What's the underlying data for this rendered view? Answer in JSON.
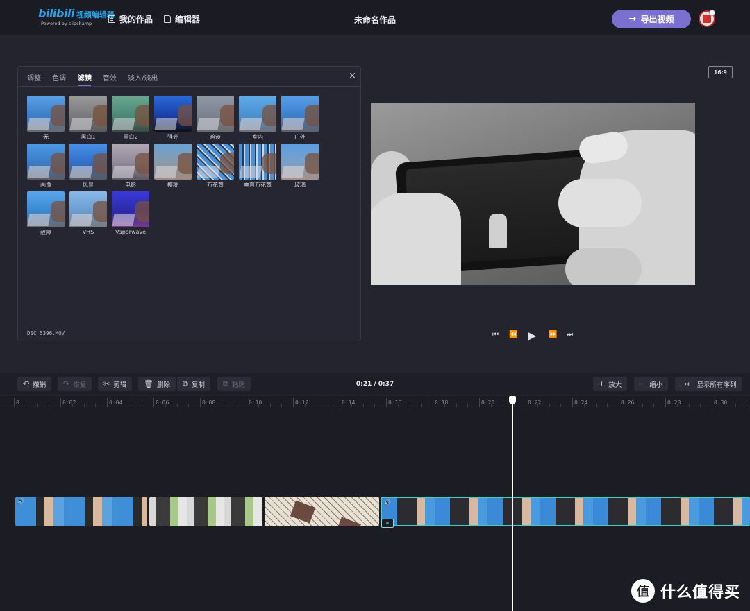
{
  "header": {
    "logo_bili": "bilibili",
    "logo_text": "视频编辑器",
    "logo_sub": "Powered by clipchamp",
    "nav_works": "我的作品",
    "nav_editor": "编辑器",
    "project_title": "未命名作品",
    "export_label": "导出视频"
  },
  "panel": {
    "tabs": [
      "调整",
      "色调",
      "滤镜",
      "音效",
      "淡入/淡出"
    ],
    "close": "×",
    "filters": [
      {
        "label": "无",
        "bg": "linear-gradient(180deg,#5aa0e6 0%,#3a7ec8 55%,#6a6a70 100%)"
      },
      {
        "label": "黑白1",
        "bg": "linear-gradient(180deg,#9a9a9a 0%,#7a7a7a 55%,#5a5a5a 100%)"
      },
      {
        "label": "黑白2",
        "bg": "linear-gradient(180deg,#6aa690 0%,#4a8a74 55%,#3a4a44 100%)"
      },
      {
        "label": "强光",
        "bg": "linear-gradient(180deg,#2a6ad8 0%,#1a40a8 55%,#101018 100%)"
      },
      {
        "label": "暗淡",
        "bg": "linear-gradient(180deg,#9098a4 0%,#7a8290 55%,#6a6a6e 100%)"
      },
      {
        "label": "室内",
        "bg": "linear-gradient(180deg,#60aae8 0%,#4a90d0 55%,#707078 100%)"
      },
      {
        "label": "户外",
        "bg": "linear-gradient(180deg,#5a9ee8 0%,#3a80cc 55%,#606068 100%)"
      },
      {
        "label": "画像",
        "bg": "linear-gradient(180deg,#4e9ae6 0%,#3a7ac4 55%,#5a5a62 100%)"
      },
      {
        "label": "风景",
        "bg": "linear-gradient(180deg,#4a90e8 0%,#2f6ec8 55%,#585860 100%)"
      },
      {
        "label": "电影",
        "bg": "linear-gradient(180deg,#b0a8b4 0%,#908898 55%,#605860 100%)"
      },
      {
        "label": "模糊",
        "bg": "linear-gradient(180deg,#6aa2d6 0%,#8a9aa8 55%,#a08a80 100%)"
      },
      {
        "label": "万花筒",
        "bg": "repeating-linear-gradient(45deg,#4a90d8 0px,#4a90d8 5px,#2a3a4a 5px,#2a3a4a 7px,#c8d8e8 7px,#c8d8e8 9px)"
      },
      {
        "label": "垂直万花筒",
        "bg": "repeating-linear-gradient(90deg,#4a90d8 0px,#4a90d8 5px,#2a3a4a 5px,#2a3a4a 7px,#c8d8e8 7px,#c8d8e8 9px)"
      },
      {
        "label": "玻璃",
        "bg": "linear-gradient(180deg,#5a9ee0 0%,#7aa0c8 55%,#a89088 100%)"
      },
      {
        "label": "故障",
        "bg": "linear-gradient(180deg,#5aa6ee 0%,#3a88d0 55%,#68686e 100%)"
      },
      {
        "label": "VHS",
        "bg": "linear-gradient(180deg,#8ab8e8 0%,#6a9cd0 55%,#7a7a80 100%)"
      },
      {
        "label": "Vaporwave",
        "bg": "linear-gradient(180deg,#3a3ad8 0%,#2a2aa8 55%,#7a3a8a 100%)"
      }
    ],
    "filename": "DSC_5396.MOV"
  },
  "preview": {
    "ratio": "16:9",
    "transport": {
      "first": "⏮",
      "back": "⏪",
      "play": "▶",
      "fwd": "⏩",
      "last": "⏭"
    }
  },
  "toolbar": {
    "undo": "撤销",
    "redo": "恢复",
    "cut": "剪辑",
    "delete": "删除",
    "copy": "复制",
    "paste": "粘贴",
    "timecode": "0:21 / 0:37",
    "zoom_in": "放大",
    "zoom_out": "缩小",
    "show_all": "显示所有序列"
  },
  "timeline": {
    "ticks": [
      "0",
      "0:02",
      "0:04",
      "0:06",
      "0:08",
      "0:10",
      "0:12",
      "0:14",
      "0:16",
      "0:18",
      "0:20",
      "0:22",
      "0:24",
      "0:26",
      "0:28",
      "0:30"
    ]
  },
  "watermark": {
    "icon": "值",
    "text": "什么值得买"
  },
  "colors": {
    "accent": "#7b6fd0",
    "selected_clip": "#3fd0c0",
    "brand": "#29a3e3"
  }
}
